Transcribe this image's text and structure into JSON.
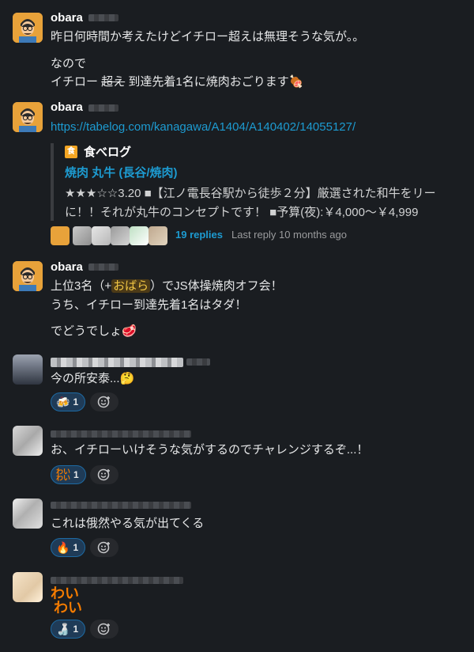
{
  "messages": [
    {
      "author": "obara",
      "lines": [
        "昨日何時間か考えたけどイチロー超えは無理そうな気が。。"
      ],
      "lines2": [
        "なので",
        "イチロー {strike}超え{/strike} 到達先着1名に焼肉おごります"
      ],
      "line2_parts": {
        "prefix": "イチロー ",
        "struck": "超え",
        "suffix": " 到達先着1名に焼肉おごります",
        "emoji": "🍖"
      }
    },
    {
      "author": "obara",
      "link": "https://tabelog.com/kanagawa/A1404/A140402/14055127/",
      "unfurl": {
        "site_name": "食べログ",
        "title": "焼肉 丸牛 (長谷/焼肉)",
        "desc_line1": "★★★☆☆3.20 ■【江ノ電長谷駅から徒歩２分】厳選された和牛をリー",
        "desc_line2": "に！！それが丸牛のコンセプトです！ ■予算(夜):￥4,000～￥4,999"
      },
      "thread": {
        "replies": "19 replies",
        "last_reply": "Last reply 10 months ago"
      }
    },
    {
      "author": "obara",
      "line1_prefix": "上位3名（+",
      "mention": "おばら",
      "line1_suffix": "）でJS体操焼肉オフ会！",
      "line2": "うち、イチロー到達先着1名はタダ！",
      "line3": "でどうでしょ",
      "line3_emoji": "🥩"
    },
    {
      "text": "今の所安泰...",
      "emoji": "🤔",
      "reaction": {
        "emoji": "🍻",
        "count": "1"
      }
    },
    {
      "text": "お、イチローいけそうな気がするのでチャレンジするぞ...！",
      "reaction": {
        "emoji": "わい\nわい",
        "count": "1"
      }
    },
    {
      "text": "これは俄然やる気が出てくる",
      "reaction": {
        "emoji": "🔥",
        "count": "1"
      }
    },
    {
      "big_emoji_line1": "わい",
      "big_emoji_line2": "わい",
      "reaction": {
        "emoji": "🍶",
        "count": "1"
      }
    }
  ],
  "icons": {
    "add_reaction": "add-reaction-icon",
    "site": "tabelog-icon"
  },
  "colors": {
    "link": "#1d9bd1",
    "background": "#1a1d21",
    "reaction_bg": "#1f3b57",
    "mention": "#f2c744"
  }
}
